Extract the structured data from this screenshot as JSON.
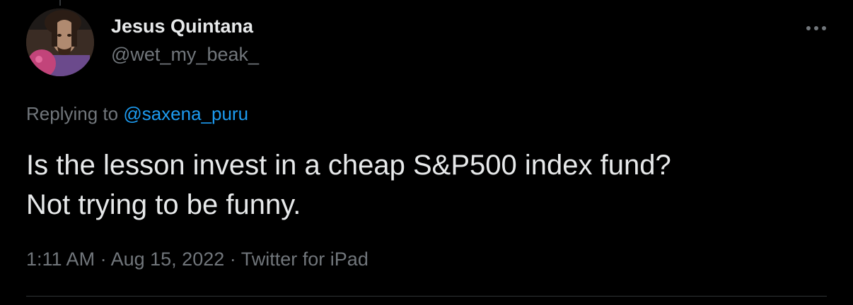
{
  "user": {
    "display_name": "Jesus Quintana",
    "handle": "@wet_my_beak_",
    "avatar_icon": "profile-photo-avatar"
  },
  "reply": {
    "prefix": "Replying to",
    "mention": "@saxena_puru"
  },
  "tweet": {
    "line1": "Is the lesson invest in a cheap S&P500 index fund?",
    "line2": "Not trying to be funny."
  },
  "meta": {
    "time": "1:11 AM",
    "separator": "·",
    "date": "Aug 15, 2022",
    "source": "Twitter for iPad"
  },
  "more_icon": "more-horizontal-icon",
  "colors": {
    "background": "#000000",
    "text": "#e7e9ea",
    "secondary": "#71767b",
    "link": "#1d9bf0",
    "divider": "#2f3336"
  }
}
